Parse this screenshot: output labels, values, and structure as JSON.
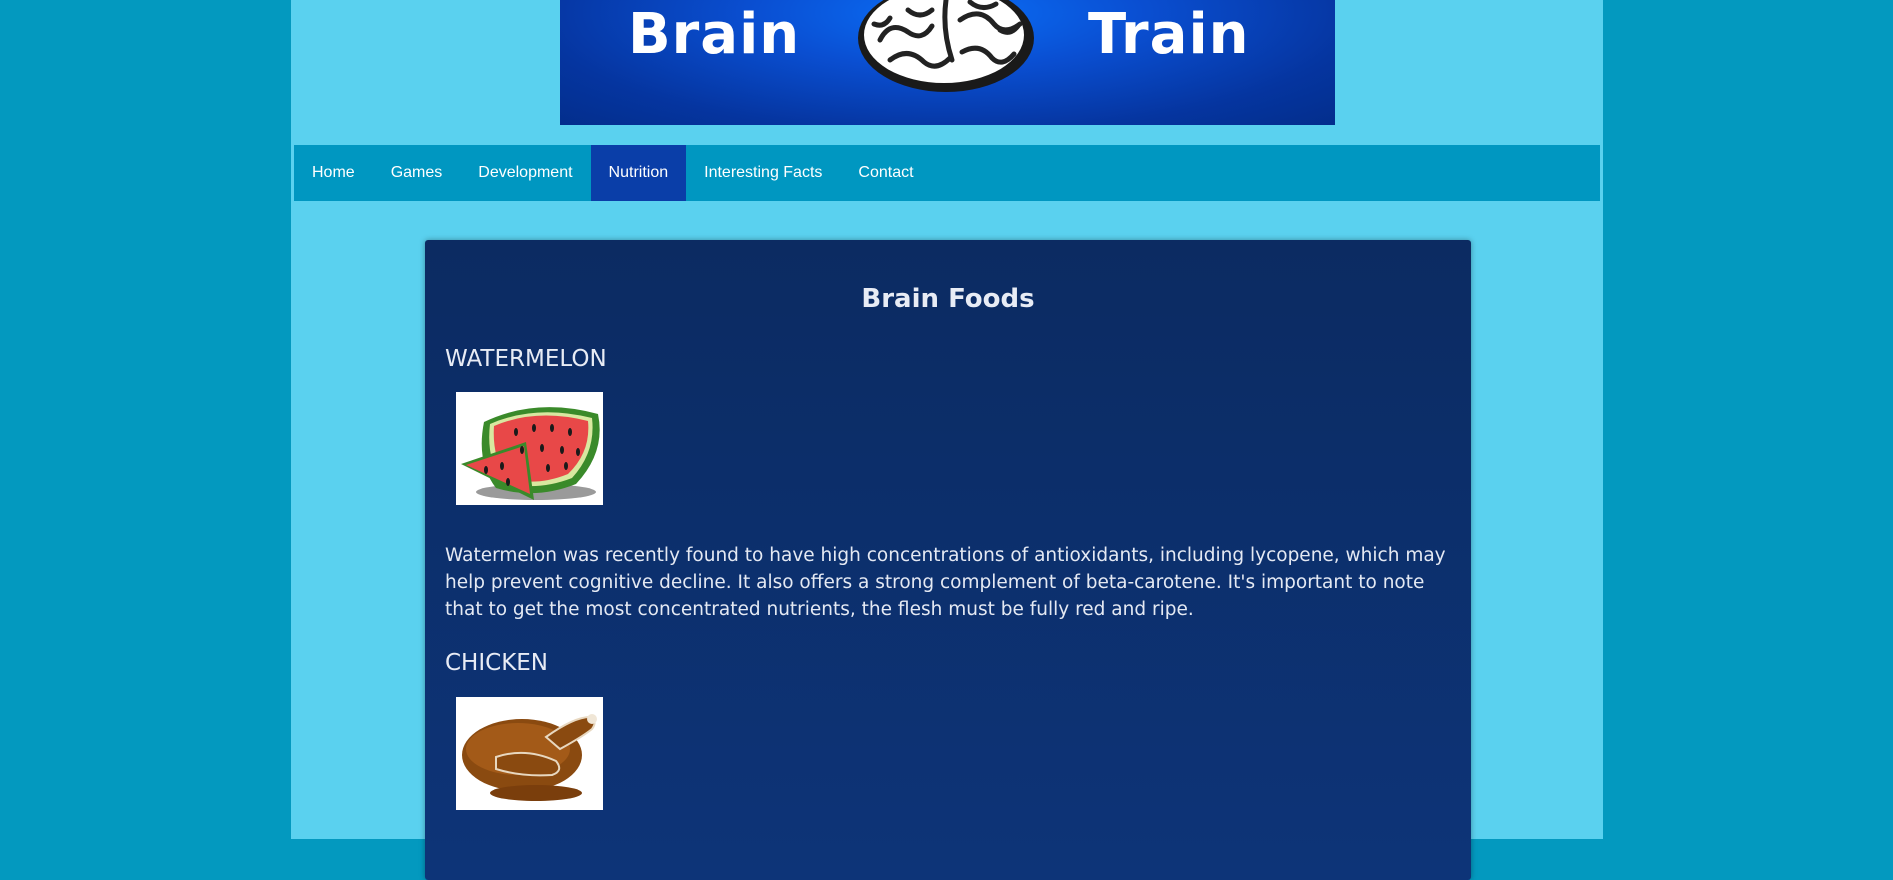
{
  "banner": {
    "word_left": "Brain",
    "word_right": "Train",
    "logo_icon": "brain-icon"
  },
  "nav": {
    "items": [
      {
        "label": "Home"
      },
      {
        "label": "Games"
      },
      {
        "label": "Development"
      },
      {
        "label": "Nutrition",
        "active": true
      },
      {
        "label": "Interesting Facts"
      },
      {
        "label": "Contact"
      }
    ]
  },
  "main": {
    "title": "Brain Foods",
    "foods": [
      {
        "name": "WATERMELON",
        "image_icon": "watermelon-image",
        "description": "Watermelon was recently found to have high concentrations of antioxidants, including lycopene, which may help prevent cognitive decline. It also offers a strong complement of beta-carotene. It's important to note that to get the most concentrated nutrients, the flesh must be fully red and ripe."
      },
      {
        "name": "CHICKEN",
        "image_icon": "roast-chicken-image"
      }
    ]
  },
  "colors": {
    "outer_background": "#0399bf",
    "page_background": "#5ad1ef",
    "nav_background": "#0097c1",
    "nav_active": "#0a3ea8",
    "content_background": "#0c2b62",
    "banner_blue": "#0a4fd2"
  }
}
